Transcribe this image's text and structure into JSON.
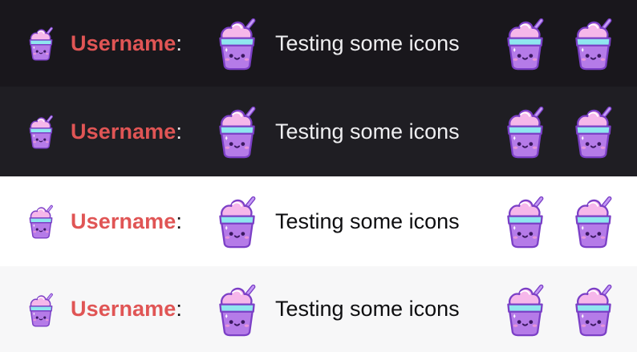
{
  "colors": {
    "username": "#e05555",
    "cup_purple": "#b57be8",
    "cup_outline": "#7b3fc6",
    "band_cyan": "#8fe6ef",
    "icecream_pink": "#f6b7ea",
    "straw": "#a66cf0"
  },
  "rows": [
    {
      "theme": "dark-1",
      "bg": "#19171c",
      "text_color": "#efeff1",
      "colon_color": "#efeff1"
    },
    {
      "theme": "dark-2",
      "bg": "#1f1e23",
      "text_color": "#efeff1",
      "colon_color": "#efeff1"
    },
    {
      "theme": "light-1",
      "bg": "#ffffff",
      "text_color": "#0e0e10",
      "colon_color": "#0e0e10"
    },
    {
      "theme": "light-2",
      "bg": "#f7f7f8",
      "text_color": "#0e0e10",
      "colon_color": "#0e0e10"
    }
  ],
  "message": {
    "username": "Username",
    "colon": ":",
    "text": "Testing some icons"
  },
  "icons": {
    "avatar": "icecream-cup-icon",
    "emote": "icecream-cup-icon"
  }
}
